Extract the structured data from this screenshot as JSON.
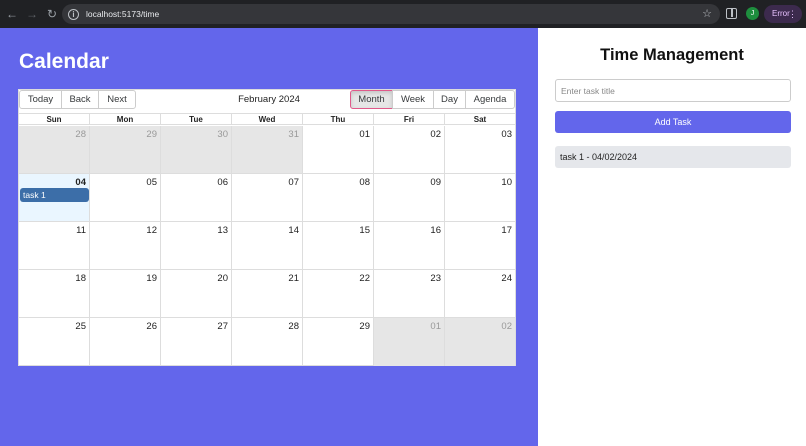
{
  "browser": {
    "url": "localhost:5173/time",
    "profile_initial": "J",
    "error_label": "Error"
  },
  "calendar": {
    "title": "Calendar",
    "toolbar": {
      "today": "Today",
      "back": "Back",
      "next": "Next",
      "label": "February 2024",
      "views": [
        "Month",
        "Week",
        "Day",
        "Agenda"
      ],
      "active_view": "Month"
    },
    "weekdays": [
      "Sun",
      "Mon",
      "Tue",
      "Wed",
      "Thu",
      "Fri",
      "Sat"
    ],
    "weeks": [
      [
        {
          "d": "28",
          "off": true
        },
        {
          "d": "29",
          "off": true
        },
        {
          "d": "30",
          "off": true
        },
        {
          "d": "31",
          "off": true
        },
        {
          "d": "01"
        },
        {
          "d": "02"
        },
        {
          "d": "03"
        }
      ],
      [
        {
          "d": "04",
          "today": true,
          "event": "task 1"
        },
        {
          "d": "05"
        },
        {
          "d": "06"
        },
        {
          "d": "07"
        },
        {
          "d": "08"
        },
        {
          "d": "09"
        },
        {
          "d": "10"
        }
      ],
      [
        {
          "d": "11"
        },
        {
          "d": "12"
        },
        {
          "d": "13"
        },
        {
          "d": "14"
        },
        {
          "d": "15"
        },
        {
          "d": "16"
        },
        {
          "d": "17"
        }
      ],
      [
        {
          "d": "18"
        },
        {
          "d": "19"
        },
        {
          "d": "20"
        },
        {
          "d": "21"
        },
        {
          "d": "22"
        },
        {
          "d": "23"
        },
        {
          "d": "24"
        }
      ],
      [
        {
          "d": "25"
        },
        {
          "d": "26"
        },
        {
          "d": "27"
        },
        {
          "d": "28"
        },
        {
          "d": "29"
        },
        {
          "d": "01",
          "off": true
        },
        {
          "d": "02",
          "off": true
        }
      ]
    ]
  },
  "tasks": {
    "title": "Time Management",
    "input_placeholder": "Enter task title",
    "input_value": "",
    "add_label": "Add Task",
    "items": [
      "task 1 - 04/02/2024"
    ]
  },
  "colors": {
    "accent": "#6366eb",
    "event": "#3c6ea8"
  }
}
